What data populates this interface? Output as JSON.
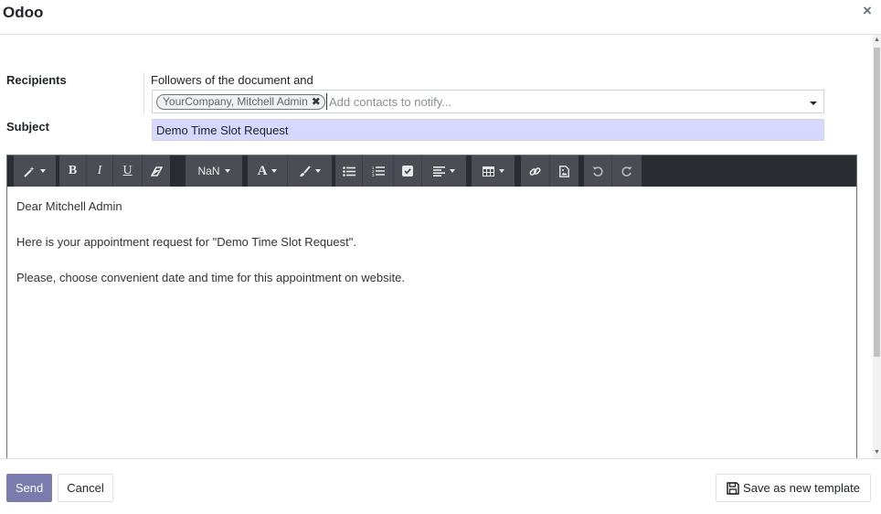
{
  "dialog": {
    "title": "Odoo",
    "close_glyph": "×"
  },
  "form": {
    "recipients_label": "Recipients",
    "followers_text": "Followers of the document and",
    "recipient_tags": [
      "YourCompany, Mitchell Admin"
    ],
    "recipients_placeholder": "Add contacts to notify...",
    "subject_label": "Subject",
    "subject_value": "Demo Time Slot Request"
  },
  "toolbar": {
    "font_size_label": "NaN",
    "icons": [
      "magic-wand-icon",
      "bold-icon",
      "italic-icon",
      "underline-icon",
      "eraser-icon",
      "font-size-dropdown",
      "font-color-icon",
      "paint-brush-icon",
      "unordered-list-icon",
      "ordered-list-icon",
      "checklist-icon",
      "align-icon",
      "table-icon",
      "link-icon",
      "image-icon",
      "undo-icon",
      "redo-icon"
    ]
  },
  "body": {
    "lines": [
      "Dear Mitchell Admin",
      "Here is your appointment request for \"Demo Time Slot Request\".",
      "Please, choose convenient date and time for this appointment on website."
    ]
  },
  "footer": {
    "send_label": "Send",
    "cancel_label": "Cancel",
    "save_template_label": "Save as new template"
  },
  "colors": {
    "primary": "#7c7bad",
    "toolbar_bg": "#292d31",
    "toolbar_button": "#4a4e54",
    "subject_highlight": "#d6d8ff"
  }
}
